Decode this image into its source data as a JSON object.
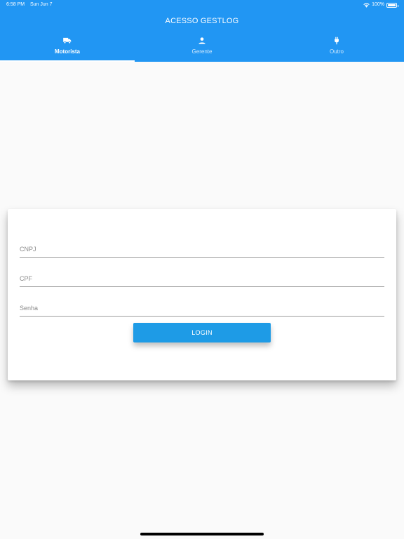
{
  "status_bar": {
    "time": "6:58 PM",
    "date": "Sun Jun 7",
    "battery": "100%",
    "wifi_icon": "wifi-icon",
    "battery_icon": "battery-icon"
  },
  "app": {
    "title": "ACESSO GESTLOG",
    "accent_color": "#2196f3"
  },
  "tabs": [
    {
      "label": "Motorista",
      "icon": "truck-icon",
      "active": true
    },
    {
      "label": "Gerente",
      "icon": "person-icon",
      "active": false
    },
    {
      "label": "Outro",
      "icon": "plug-icon",
      "active": false
    }
  ],
  "form": {
    "cnpj_placeholder": "CNPJ",
    "cnpj_value": "",
    "cpf_placeholder": "CPF",
    "cpf_value": "",
    "senha_placeholder": "Senha",
    "senha_value": "",
    "login_label": "LOGIN",
    "button_color": "#1e9be6"
  }
}
